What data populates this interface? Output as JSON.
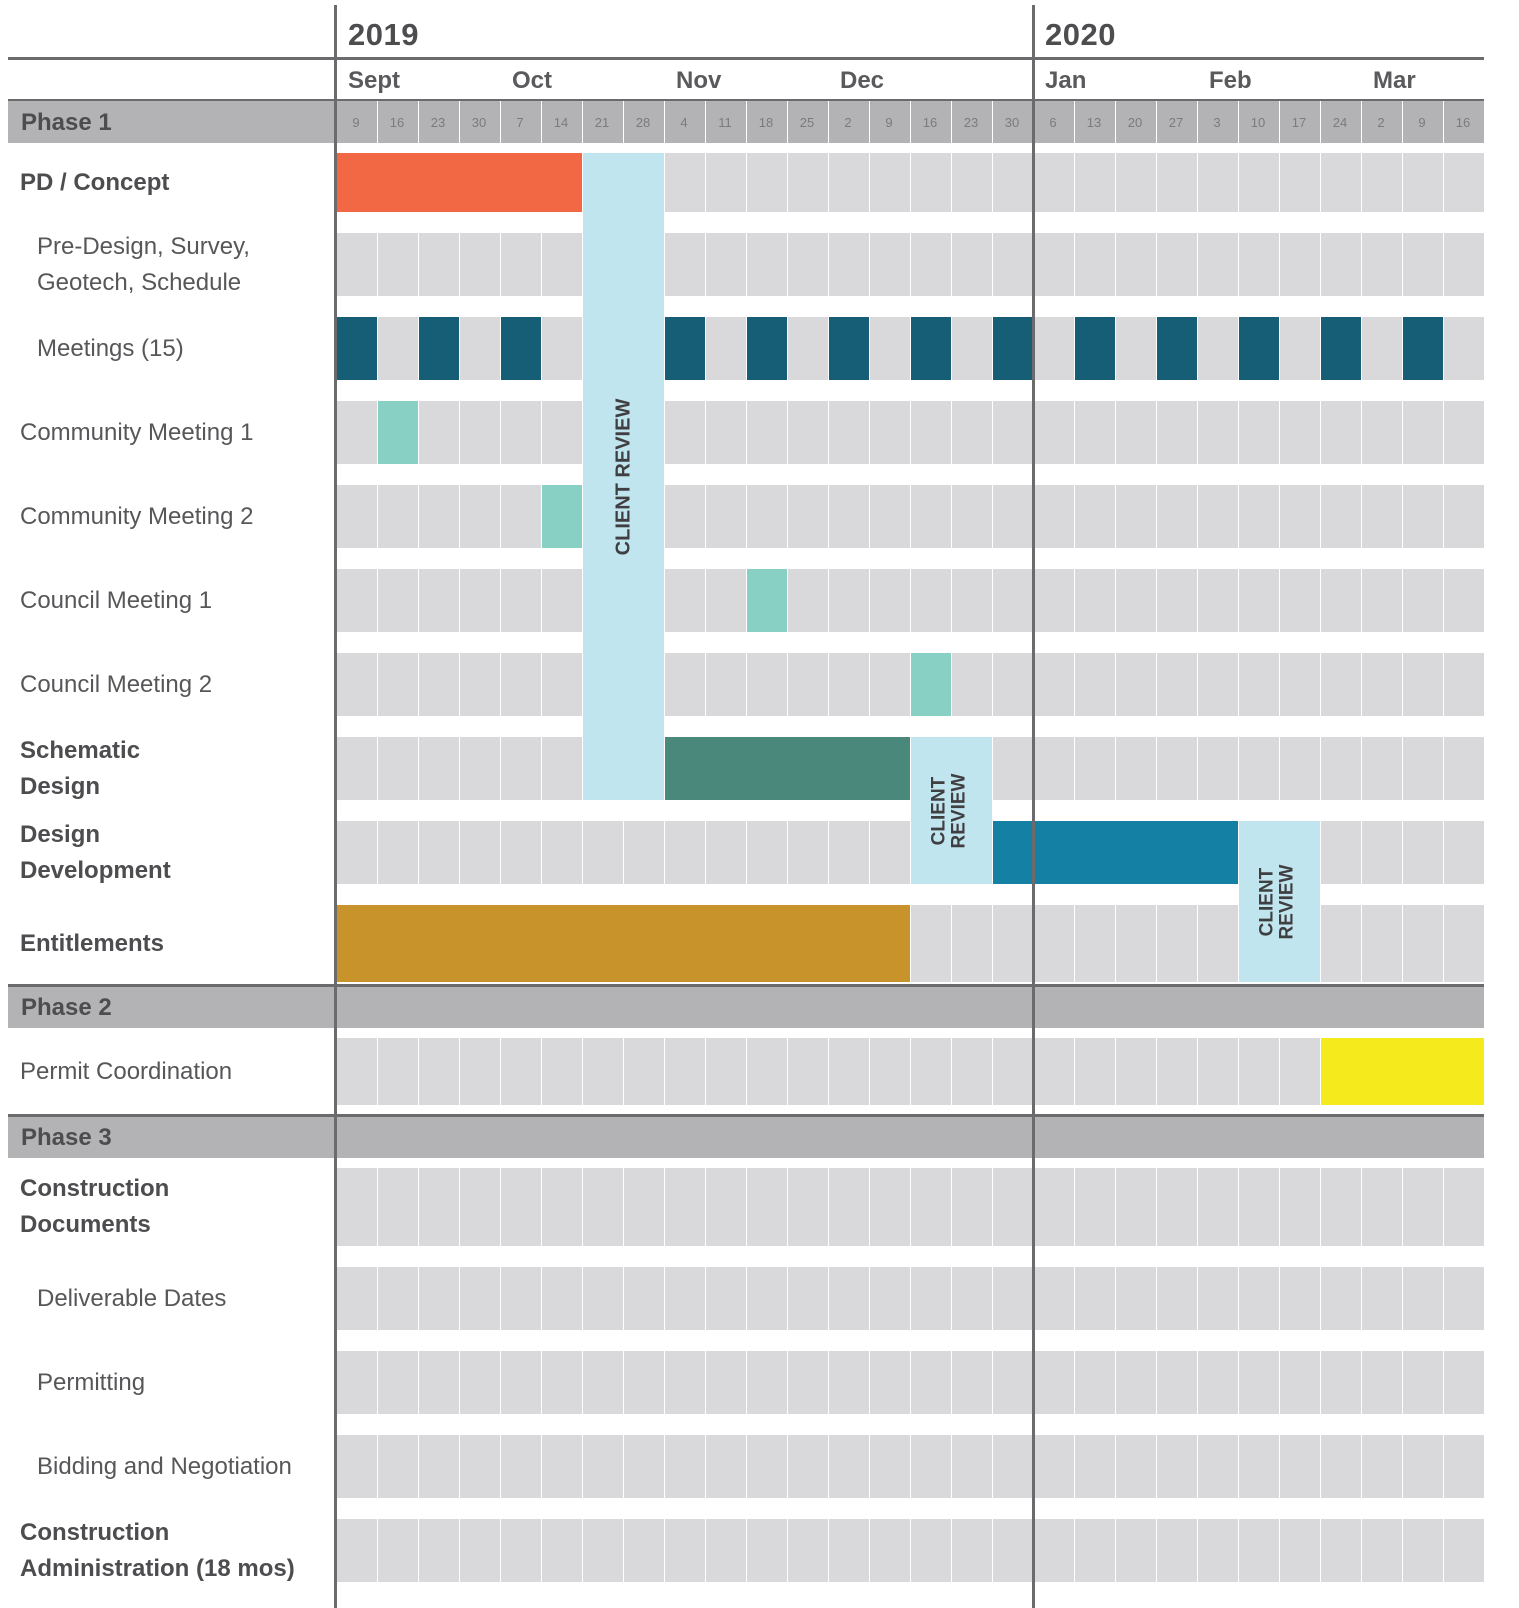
{
  "chart_data": {
    "type": "gantt",
    "years": [
      "2019",
      "2020"
    ],
    "months": [
      "Sept",
      "Oct",
      "Nov",
      "Dec",
      "Jan",
      "Feb",
      "Mar"
    ],
    "weeks": [
      "9",
      "16",
      "23",
      "30",
      "7",
      "14",
      "21",
      "28",
      "4",
      "11",
      "18",
      "25",
      "2",
      "9",
      "16",
      "23",
      "30",
      "6",
      "13",
      "20",
      "27",
      "3",
      "10",
      "17",
      "24",
      "2",
      "9",
      "16"
    ],
    "phases": [
      {
        "label": "Phase 1",
        "rows": [
          {
            "label": "PD / Concept",
            "bold": true,
            "indent": false,
            "bars": [
              {
                "start": 0,
                "end": 6,
                "color": "#f26744"
              }
            ]
          },
          {
            "label": "Pre-Design, Survey,\nGeotech, Schedule",
            "bold": false,
            "indent": true,
            "bars": []
          },
          {
            "label": "Meetings (15)",
            "bold": false,
            "indent": true,
            "bars": [
              {
                "start": 0,
                "end": 1,
                "color": "#165e75"
              },
              {
                "start": 2,
                "end": 3,
                "color": "#165e75"
              },
              {
                "start": 4,
                "end": 5,
                "color": "#165e75"
              },
              {
                "start": 8,
                "end": 9,
                "color": "#165e75"
              },
              {
                "start": 10,
                "end": 11,
                "color": "#165e75"
              },
              {
                "start": 12,
                "end": 13,
                "color": "#165e75"
              },
              {
                "start": 14,
                "end": 15,
                "color": "#165e75"
              },
              {
                "start": 16,
                "end": 17,
                "color": "#165e75"
              },
              {
                "start": 18,
                "end": 19,
                "color": "#165e75"
              },
              {
                "start": 20,
                "end": 21,
                "color": "#165e75"
              },
              {
                "start": 22,
                "end": 23,
                "color": "#165e75"
              },
              {
                "start": 24,
                "end": 25,
                "color": "#165e75"
              },
              {
                "start": 26,
                "end": 27,
                "color": "#165e75"
              }
            ]
          },
          {
            "label": "Community Meeting 1",
            "bold": false,
            "indent": false,
            "bars": [
              {
                "start": 1,
                "end": 2,
                "color": "#88d0c4"
              }
            ]
          },
          {
            "label": "Community Meeting 2",
            "bold": false,
            "indent": false,
            "bars": [
              {
                "start": 5,
                "end": 6,
                "color": "#88d0c4"
              }
            ]
          },
          {
            "label": "Council Meeting 1",
            "bold": false,
            "indent": false,
            "bars": [
              {
                "start": 10,
                "end": 11,
                "color": "#88d0c4"
              }
            ]
          },
          {
            "label": "Council Meeting 2",
            "bold": false,
            "indent": false,
            "bars": [
              {
                "start": 14,
                "end": 15,
                "color": "#88d0c4"
              }
            ]
          },
          {
            "label": "Schematic\nDesign",
            "bold": true,
            "indent": false,
            "bars": [
              {
                "start": 8,
                "end": 14,
                "color": "#4a887b"
              }
            ]
          },
          {
            "label": "Design\nDevelopment",
            "bold": true,
            "indent": false,
            "bars": [
              {
                "start": 16,
                "end": 22,
                "color": "#1480a3"
              }
            ]
          },
          {
            "label": "Entitlements",
            "bold": true,
            "indent": false,
            "bars": [
              {
                "start": 0,
                "end": 14,
                "color": "#c8932a"
              }
            ]
          }
        ]
      },
      {
        "label": "Phase 2",
        "rows": [
          {
            "label": "Permit Coordination",
            "bold": false,
            "indent": false,
            "bars": [
              {
                "start": 24,
                "end": 28,
                "color": "#f5ea1c"
              }
            ]
          }
        ]
      },
      {
        "label": "Phase 3",
        "rows": [
          {
            "label": "Construction\nDocuments",
            "bold": true,
            "indent": false,
            "bars": []
          },
          {
            "label": "Deliverable Dates",
            "bold": false,
            "indent": true,
            "bars": []
          },
          {
            "label": "Permitting",
            "bold": false,
            "indent": true,
            "bars": []
          },
          {
            "label": "Bidding and Negotiation",
            "bold": false,
            "indent": true,
            "bars": []
          },
          {
            "label": "Construction\nAdministration (18 mos)",
            "bold": true,
            "indent": false,
            "bars": []
          }
        ]
      }
    ],
    "reviews": [
      {
        "label": "CLIENT REVIEW",
        "start": 6,
        "end": 8,
        "from_row": 0,
        "to_row": 7,
        "color": "#c0e5ee"
      },
      {
        "label": "CLIENT\nREVIEW",
        "start": 14,
        "end": 16,
        "from_row": 7,
        "to_row": 8,
        "color": "#c0e5ee"
      },
      {
        "label": "CLIENT\nREVIEW",
        "start": 22,
        "end": 24,
        "from_row": 8,
        "to_row": 9,
        "color": "#c0e5ee"
      }
    ],
    "colors": {
      "cell": "#d9d9db",
      "phase_bar": "#b3b3b6",
      "divider": "#6b6b6e"
    }
  }
}
